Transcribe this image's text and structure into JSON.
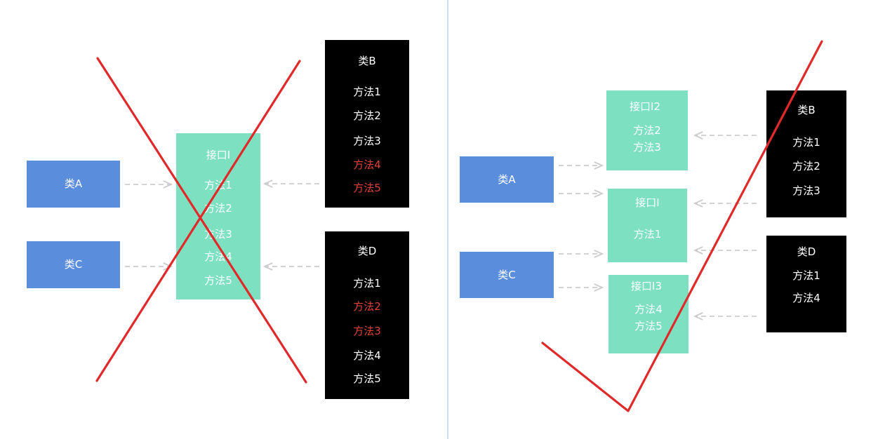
{
  "left": {
    "classA": "类A",
    "classC": "类C",
    "interface": {
      "title": "接口I",
      "methods": [
        "方法1",
        "方法2",
        "方法3",
        "方法4",
        "方法5"
      ]
    },
    "classB": {
      "title": "类B",
      "methods": [
        "方法1",
        "方法2",
        "方法3",
        "方法4",
        "方法5"
      ]
    },
    "classD": {
      "title": "类D",
      "methods": [
        "方法1",
        "方法2",
        "方法3",
        "方法4",
        "方法5"
      ]
    }
  },
  "right": {
    "classA": "类A",
    "classC": "类C",
    "interfaceI2": {
      "title": "接口I2",
      "methods": [
        "方法2",
        "方法3"
      ]
    },
    "interfaceI": {
      "title": "接口I",
      "methods": [
        "方法1"
      ]
    },
    "interfaceI3": {
      "title": "接口I3",
      "methods": [
        "方法4",
        "方法5"
      ]
    },
    "classB": {
      "title": "类B",
      "methods": [
        "方法1",
        "方法2",
        "方法3"
      ]
    },
    "classD": {
      "title": "类D",
      "methods": [
        "方法1",
        "方法4"
      ]
    }
  },
  "colors": {
    "blue": "#5b8ddd",
    "teal": "#7de0c0",
    "black": "#000000",
    "red_mark": "#e02a2a",
    "red_text": "#e0413a",
    "arrow": "#cccccc"
  },
  "icons": {
    "left_mark": "cross-mark",
    "right_mark": "check-mark"
  }
}
